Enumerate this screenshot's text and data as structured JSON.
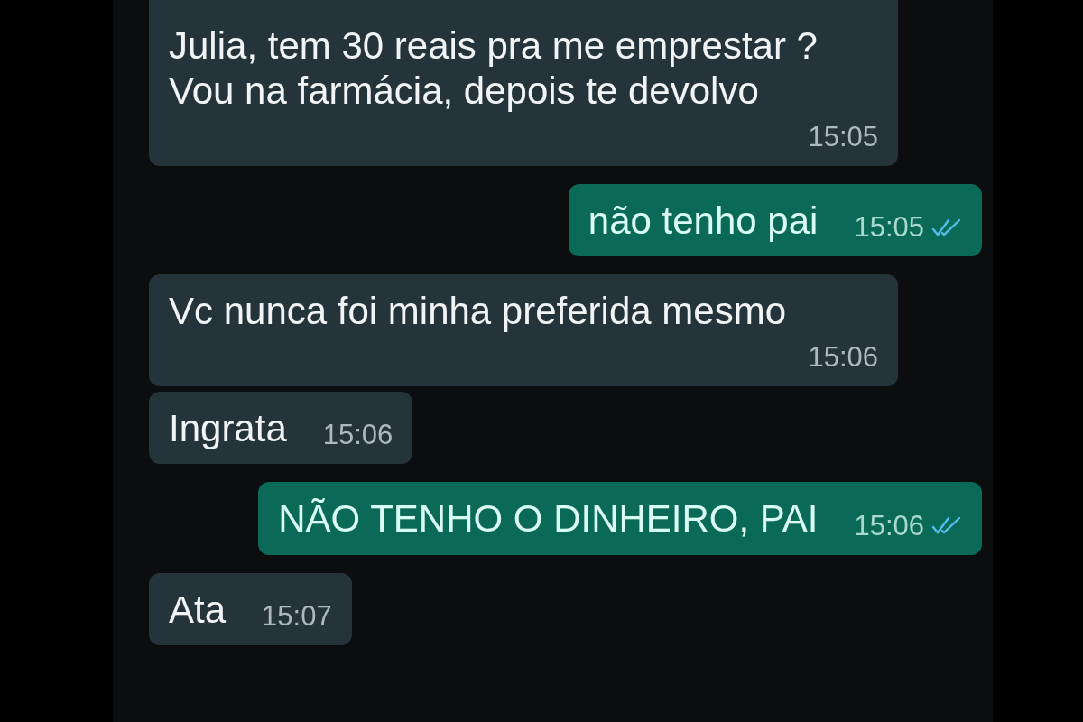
{
  "messages": [
    {
      "kind": "incoming",
      "text": "Julia, tem 30 reais pra me emprestar ?\nVou na farmácia, depois te devolvo",
      "time": "15:05"
    },
    {
      "kind": "outgoing",
      "text": "não tenho pai",
      "time": "15:05",
      "read": true
    },
    {
      "kind": "incoming",
      "text": "Vc nunca foi minha preferida mesmo",
      "time": "15:06"
    },
    {
      "kind": "incoming",
      "text": "Ingrata",
      "time": "15:06"
    },
    {
      "kind": "outgoing",
      "text": "NÃO TENHO O DINHEIRO, PAI",
      "time": "15:06",
      "read": true
    },
    {
      "kind": "incoming",
      "text": "Ata",
      "time": "15:07"
    }
  ]
}
